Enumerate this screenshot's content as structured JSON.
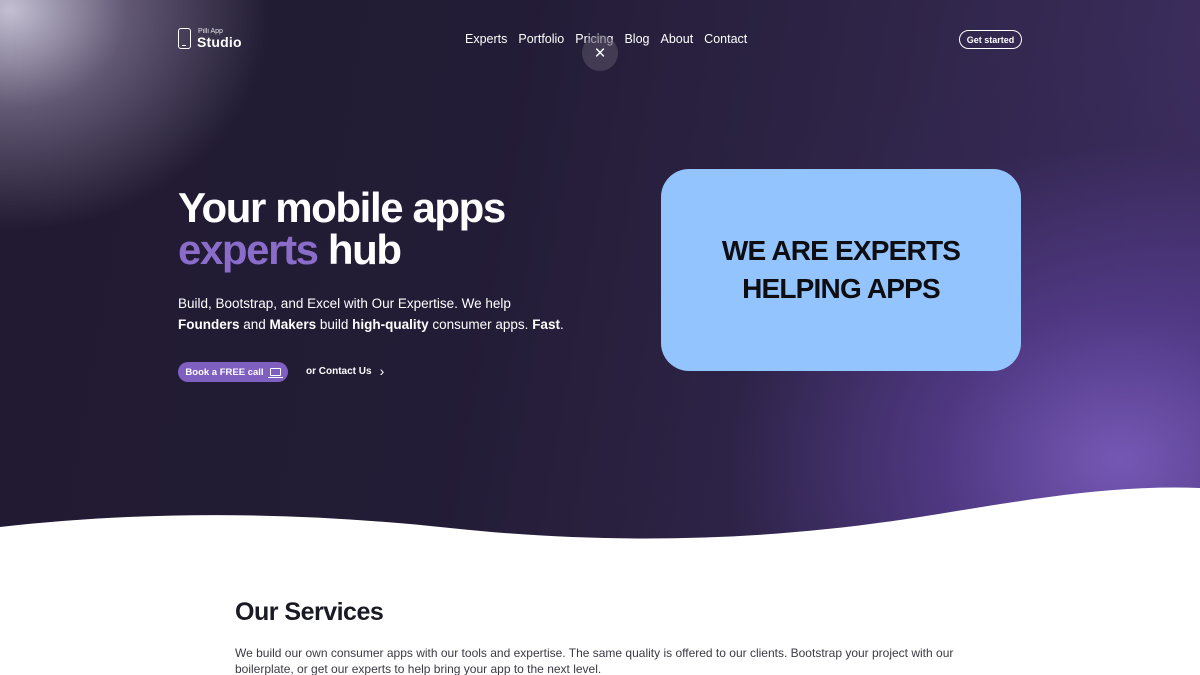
{
  "brand": {
    "small": "Pilli App",
    "name": "Studio"
  },
  "nav": {
    "items": [
      "Experts",
      "Portfolio",
      "Pricing",
      "Blog",
      "About",
      "Contact"
    ]
  },
  "header": {
    "close_label": "×",
    "get_started": "Get started"
  },
  "hero": {
    "line1": "Your mobile apps",
    "line2_accent": "experts",
    "line2_rest": " hub",
    "sub_1": "Build, Bootstrap, and Excel with Our Expertise. We help",
    "sub_founders": "Founders",
    "sub_and": " and ",
    "sub_makers": "Makers",
    "sub_build": " build ",
    "sub_quality": "high-quality",
    "sub_consumer": " consumer apps. ",
    "sub_fast": "Fast",
    "sub_period": ".",
    "book_button": "Book a FREE call",
    "contact_link": "or Contact Us",
    "chevron": "›"
  },
  "card": {
    "line1": "WE ARE EXPERTS",
    "line2": "HELPING APPS"
  },
  "services": {
    "title": "Our Services",
    "text": "We build our own consumer apps with our tools and expertise. The same quality is offered to our clients. Bootstrap your project with our boilerplate, or get our experts to help bring your app to the next level."
  },
  "colors": {
    "accent": "#7f5fc0",
    "card_bg": "#93c4fd",
    "hero_dark": "#211a31"
  },
  "icons": [
    "phone-logo-icon",
    "close-icon",
    "laptop-icon",
    "chevron-right-icon"
  ]
}
